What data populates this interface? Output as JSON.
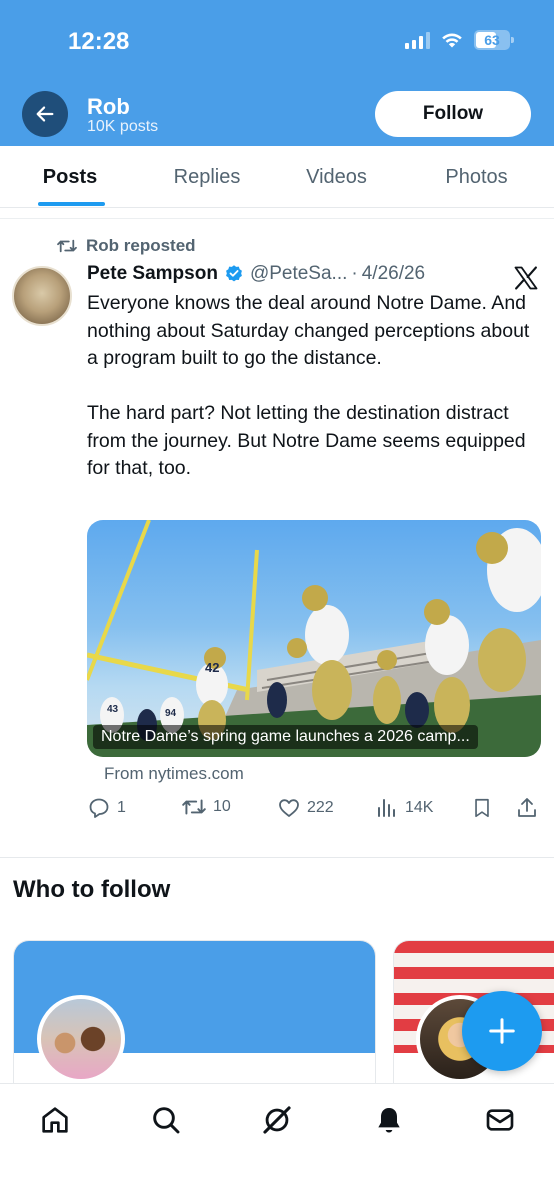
{
  "status_bar": {
    "time": "12:28",
    "battery": "63",
    "battery_level_percent": 63
  },
  "header": {
    "name": "Rob",
    "posts_count": "10K posts",
    "follow_label": "Follow",
    "color": "#4a9ee8"
  },
  "tabs": [
    {
      "label": "Posts",
      "active": true
    },
    {
      "label": "Replies",
      "active": false
    },
    {
      "label": "Videos",
      "active": false
    },
    {
      "label": "Photos",
      "active": false
    }
  ],
  "post": {
    "repost_label": "Rob reposted",
    "author_name": "Pete Sampson",
    "author_handle": "@PeteSa...",
    "separator": "·",
    "date": "4/26/26",
    "verified": true,
    "text": "Everyone knows the deal around Notre Dame. And nothing about Saturday changed perceptions about a program built to go the distance.\n\nThe hard part? Not letting the destination distract from the journey. But Notre Dame seems equipped for that, too.",
    "media": {
      "caption": "Notre Dame’s spring game launches a 2026 camp...",
      "source": "From nytimes.com"
    },
    "stats": {
      "replies": "1",
      "reposts": "10",
      "likes": "222",
      "views": "14K"
    }
  },
  "who_to_follow": {
    "title": "Who to follow"
  },
  "icons": [
    "back-arrow-icon",
    "verified-badge-icon",
    "x-logo-icon",
    "repost-icon",
    "reply-icon",
    "like-icon",
    "views-icon",
    "bookmark-icon",
    "share-icon",
    "compose-plus-icon",
    "home-icon",
    "search-icon",
    "grok-icon",
    "notifications-icon",
    "messages-icon"
  ],
  "colors": {
    "accent": "#1d9bf0",
    "text": "#0f1419",
    "muted": "#536471"
  }
}
